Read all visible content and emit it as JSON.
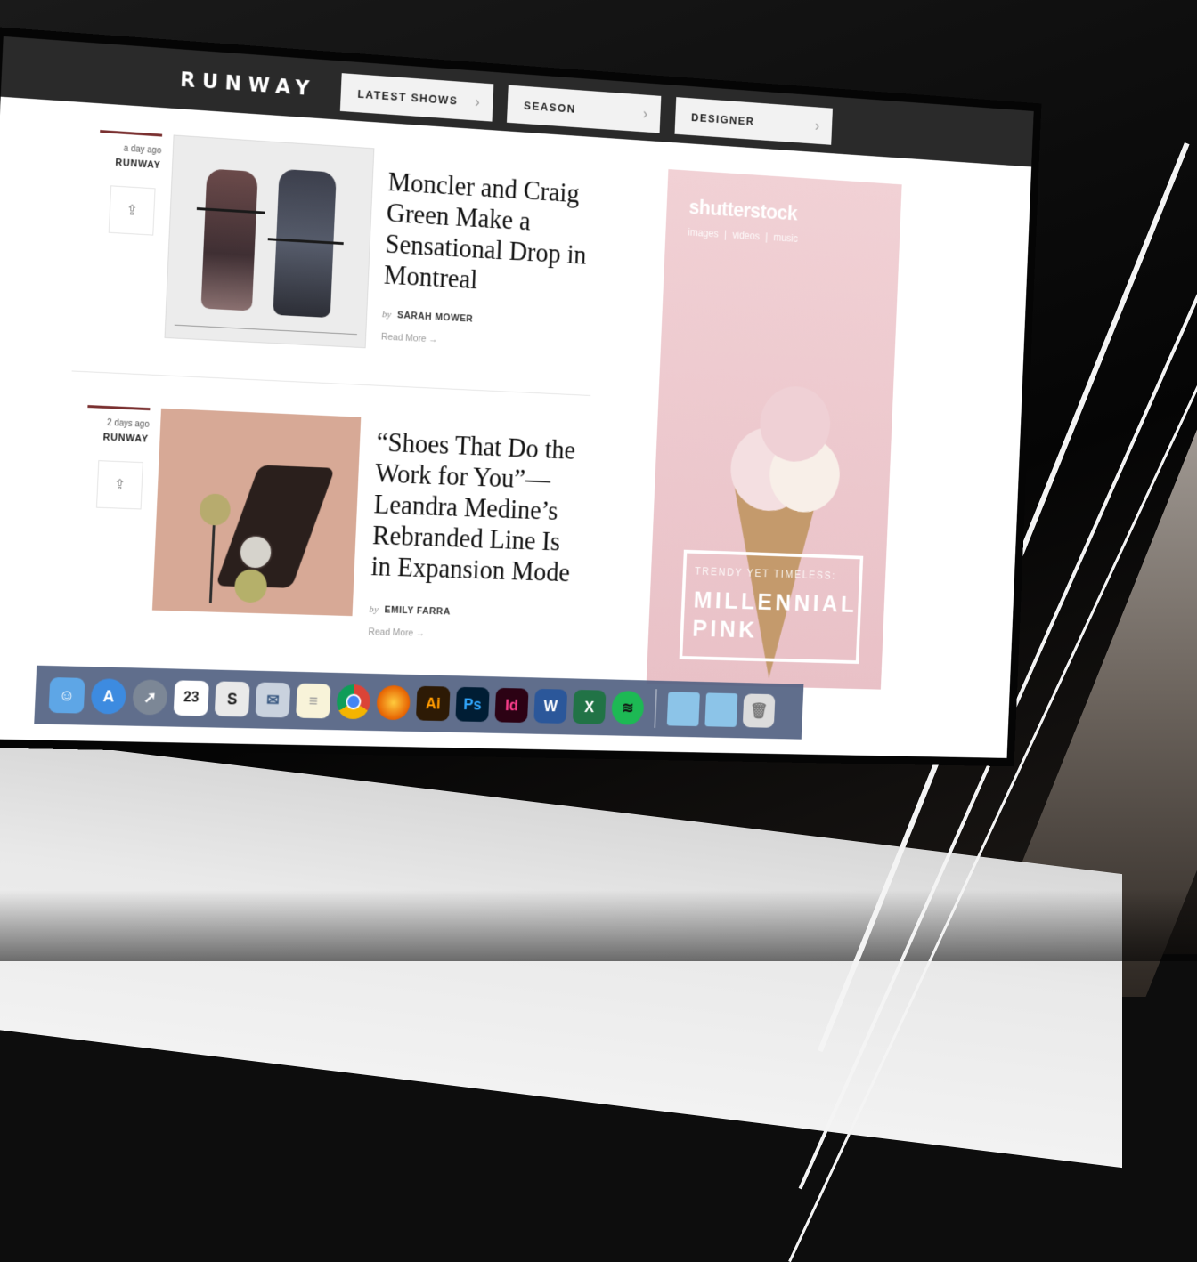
{
  "brand": {
    "name": "RUNWAY"
  },
  "nav": [
    {
      "label": "LATEST SHOWS"
    },
    {
      "label": "SEASON"
    },
    {
      "label": "DESIGNER"
    }
  ],
  "articles": [
    {
      "time": "a day ago",
      "section": "RUNWAY",
      "headline": "Moncler and Craig Green Make a Sensational Drop in Montreal",
      "by": "by",
      "author": "SARAH MOWER",
      "read_more": "Read More →"
    },
    {
      "time": "2 days ago",
      "section": "RUNWAY",
      "headline": "“Shoes That Do the Work for You”— Leandra Medine’s Rebranded Line Is in Expansion Mode",
      "by": "by",
      "author": "EMILY FARRA",
      "read_more": "Read More →"
    }
  ],
  "ad": {
    "logo": "shutterstock",
    "tags": "images | videos | music",
    "kicker": "TRENDY YET TIMELESS:",
    "headline": "MILLENNIAL PINK"
  },
  "dock": {
    "calendar_day": "23",
    "ai": "Ai",
    "ps": "Ps",
    "id": "Id",
    "word": "W",
    "excel": "X",
    "s_app": "S"
  },
  "colors": {
    "topbar": "#2a2a2a",
    "accent_rule": "#7a3030",
    "ad_pink": "#f1d1d5"
  }
}
